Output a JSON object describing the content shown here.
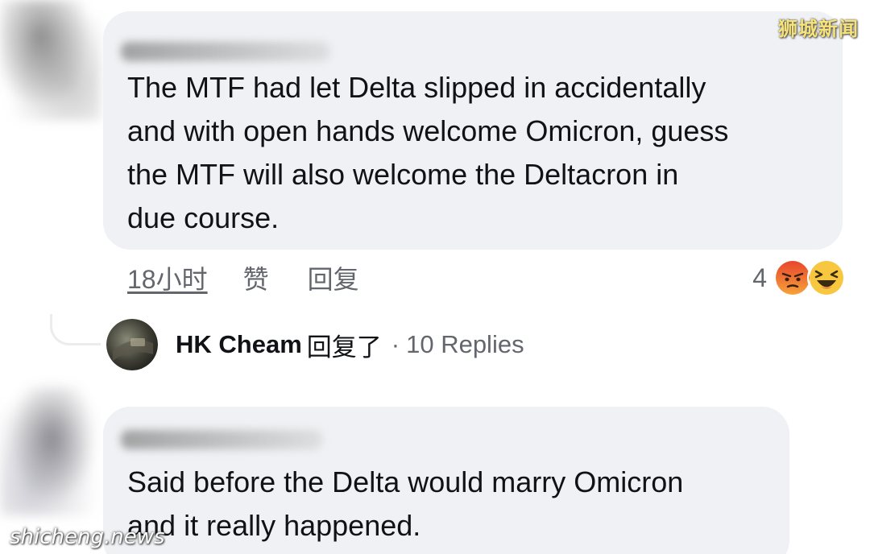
{
  "watermarks": {
    "top_right": "狮城新闻",
    "bottom_left": "shicheng.news"
  },
  "comment_1": {
    "text_lines": [
      "The MTF had let Delta slipped in accidentally",
      "and with open hands welcome Omicron, guess",
      "the MTF  will also welcome the Deltacron in",
      "due course."
    ],
    "time": "18小时",
    "like_label": "赞",
    "reply_label": "回复",
    "reaction_count": "4",
    "reactions": [
      "angry-emoji",
      "laughing-emoji"
    ]
  },
  "replies": {
    "author": "HK Cheam",
    "verb": "回复了",
    "separator": "·",
    "count_label": "10 Replies"
  },
  "comment_2": {
    "text_lines": [
      "Said before the Delta would marry Omicron",
      "and it really happened."
    ]
  },
  "colors": {
    "bubble_bg": "#f0f1f4",
    "text_primary": "#111216",
    "text_secondary": "#63666d",
    "angry_emoji": "#f0603a",
    "laugh_emoji": "#f7c740"
  }
}
